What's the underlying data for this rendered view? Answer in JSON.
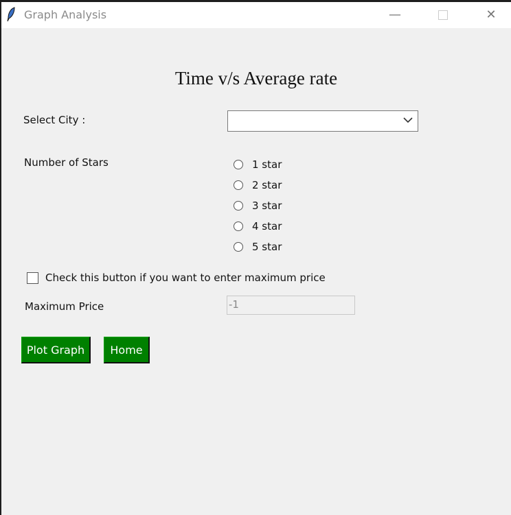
{
  "window": {
    "title": "Graph Analysis",
    "icon": "feather-icon"
  },
  "heading": "Time v/s Average rate",
  "city": {
    "label": "Select City :",
    "value": ""
  },
  "stars": {
    "label": "Number of Stars",
    "options": [
      "1 star",
      "2 star",
      "3 star",
      "4 star",
      "5 star"
    ]
  },
  "max_price_checkbox": {
    "label": "Check this button if you want to enter maximum price",
    "checked": false
  },
  "max_price": {
    "label": "Maximum Price",
    "value": "-1"
  },
  "buttons": {
    "plot": "Plot Graph",
    "home": "Home"
  },
  "colors": {
    "button_bg": "#008000",
    "window_bg": "#f0f0f0"
  }
}
